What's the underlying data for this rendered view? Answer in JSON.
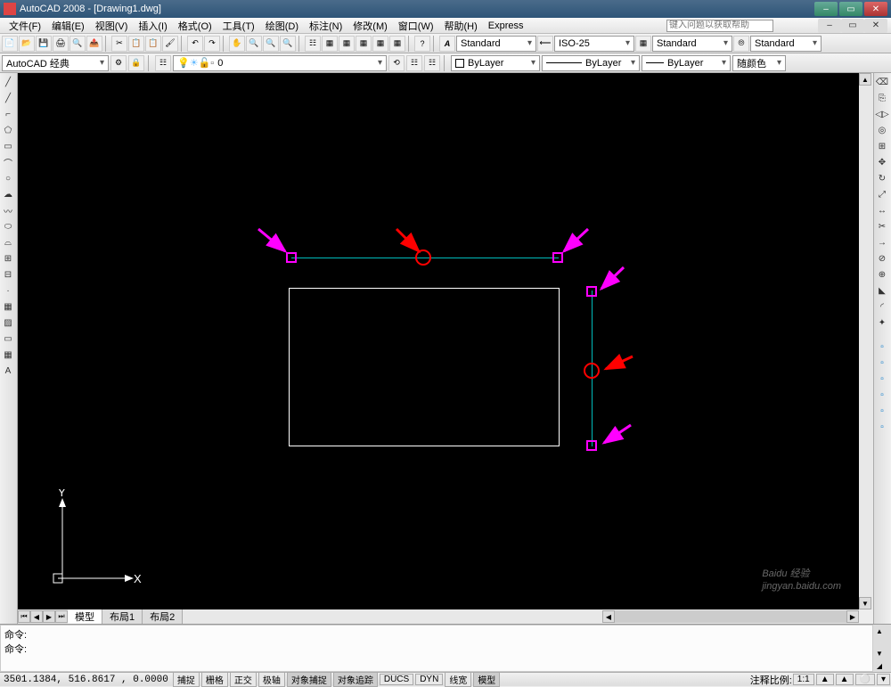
{
  "title": "AutoCAD 2008 - [Drawing1.dwg]",
  "help_placeholder": "键入问题以获取帮助",
  "menu": [
    "文件(F)",
    "编辑(E)",
    "视图(V)",
    "插入(I)",
    "格式(O)",
    "工具(T)",
    "绘图(D)",
    "标注(N)",
    "修改(M)",
    "窗口(W)",
    "帮助(H)",
    "Express"
  ],
  "style_sel": "Standard",
  "dim_sel": "ISO-25",
  "tbl_sel": "Standard",
  "std_sel": "Standard",
  "workspace_sel": "AutoCAD 经典",
  "layer_sel": "0",
  "bylayer1": "ByLayer",
  "bylayer2": "ByLayer",
  "bylayer3": "ByLayer",
  "color_sel": "随颜色",
  "tabs": {
    "model": "模型",
    "layout1": "布局1",
    "layout2": "布局2"
  },
  "cmd1": "命令:",
  "cmd2": "命令:",
  "coord": "3501.1384, 516.8617 , 0.0000",
  "modes": [
    "捕捉",
    "栅格",
    "正交",
    "极轴",
    "对象捕捉",
    "对象追踪",
    "DUCS",
    "DYN",
    "线宽",
    "模型"
  ],
  "scale_label": "注释比例:",
  "scale_val": "1:1",
  "watermark": "Baidu 经验",
  "watermark_url": "jingyan.baidu.com",
  "ucs": {
    "x": "X",
    "y": "Y"
  }
}
